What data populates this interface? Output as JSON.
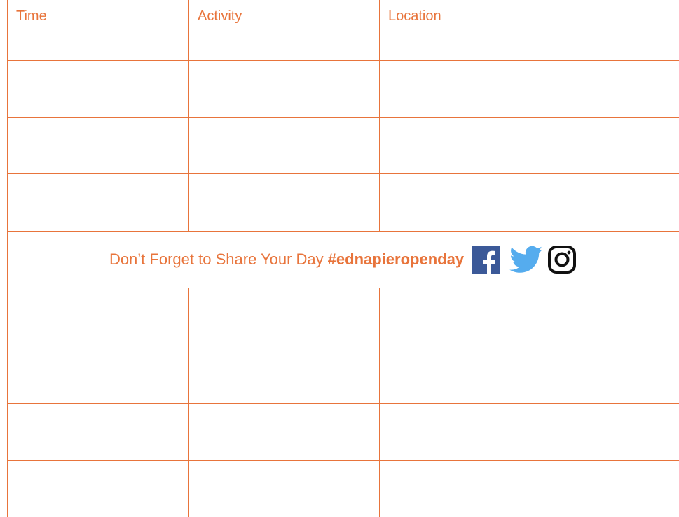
{
  "table": {
    "headers": {
      "time": "Time",
      "activity": "Activity",
      "location": "Location"
    }
  },
  "share_banner": {
    "text": "Don’t Forget to Share Your Day",
    "hashtag": "#ednapieropenday",
    "icons": [
      "facebook-icon",
      "twitter-icon",
      "instagram-icon"
    ]
  },
  "colors": {
    "accent": "#e8743b",
    "facebook": "#3b5998",
    "twitter": "#55acee",
    "instagram": "#111111"
  }
}
